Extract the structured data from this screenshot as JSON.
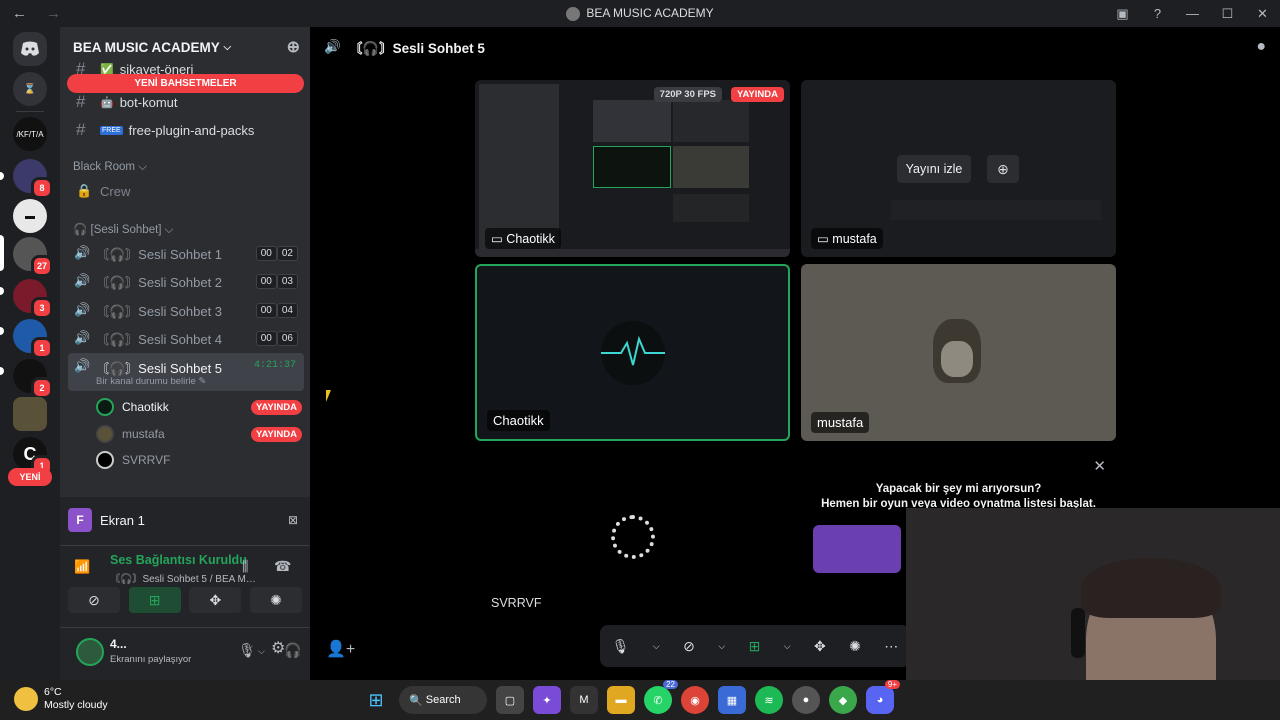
{
  "window": {
    "title": "BEA MUSIC ACADEMY",
    "back": "←",
    "forward": "→"
  },
  "titlebar_icons": [
    "inbox-icon",
    "help-icon",
    "minimize-icon",
    "maximize-icon",
    "close-icon"
  ],
  "guilds": {
    "items": [
      {
        "name": "discord-home",
        "badge": ""
      },
      {
        "name": "hourglass",
        "badge": ""
      },
      {
        "name": "server-text",
        "label": "/KF/T/A",
        "badge": ""
      },
      {
        "name": "server-a",
        "badge": "8"
      },
      {
        "name": "server-b",
        "badge": ""
      },
      {
        "name": "server-c",
        "badge": "27"
      },
      {
        "name": "server-d",
        "badge": "3"
      },
      {
        "name": "server-e",
        "badge": "1"
      },
      {
        "name": "server-f",
        "badge": "2"
      },
      {
        "name": "server-g",
        "badge": ""
      },
      {
        "name": "server-h",
        "badge": "1"
      }
    ],
    "new_label": "YENİ"
  },
  "server": {
    "name": "BEA MUSIC ACADEMY"
  },
  "mentions_banner": "YENİ BAHSETMELER",
  "text_channels": [
    {
      "name": "şikayet-öneri",
      "emoji": "✅"
    },
    {
      "name": "bot-komut",
      "emoji": "🤖"
    },
    {
      "name": "free-plugin-and-packs",
      "emoji": "FREE"
    }
  ],
  "categories": {
    "black_room": "Black Room",
    "sesli": "🎧 [Sesli Sohbet]"
  },
  "crew_channel": "Crew",
  "voice_channels": [
    {
      "name": "〘🎧〙Sesli Sohbet 1",
      "count_a": "00",
      "count_b": "02"
    },
    {
      "name": "〘🎧〙Sesli Sohbet 2",
      "count_a": "00",
      "count_b": "03"
    },
    {
      "name": "〘🎧〙Sesli Sohbet 3",
      "count_a": "00",
      "count_b": "04"
    },
    {
      "name": "〘🎧〙Sesli Sohbet 4",
      "count_a": "00",
      "count_b": "06"
    }
  ],
  "active_voice": {
    "name": "〘🎧〙Sesli Sohbet 5",
    "timer": "4:21:37",
    "status": "Bir kanal durumu belirle ✎"
  },
  "members": [
    {
      "name": "Chaotikk",
      "live": "YAYINDA"
    },
    {
      "name": "mustafa",
      "live": "YAYINDA"
    },
    {
      "name": "SVRRVF",
      "live": ""
    }
  ],
  "screen_share": {
    "icon_letter": "F",
    "label": "Ekran 1"
  },
  "connection": {
    "title": "Ses Bağlantısı Kuruldu",
    "subtitle": "〘🎧〙Sesli Sohbet 5 / BEA MUSIC AC..."
  },
  "user": {
    "name": "4...",
    "status": "Ekranını paylaşıyor"
  },
  "main_header": {
    "channel": "〘🎧〙Sesli Sohbet 5"
  },
  "tiles": {
    "stream1": {
      "name": "Chaotikk",
      "quality": "720P 30 FPS",
      "live": "YAYINDA"
    },
    "stream2": {
      "name": "mustafa",
      "watch": "Yayını izle"
    },
    "cam1": {
      "name": "Chaotikk"
    },
    "cam2": {
      "name": "mustafa"
    },
    "cam3": {
      "name": "SVRRVF"
    }
  },
  "activity": {
    "line1": "Yapacak bir şey mi arıyorsun?",
    "line2": "Hemen bir oyun veya video oynatma listesi başlat."
  },
  "taskbar": {
    "temp": "6°C",
    "weather": "Mostly cloudy",
    "search": "Search",
    "whatsapp_badge": "22",
    "discord_badge": "9+"
  }
}
